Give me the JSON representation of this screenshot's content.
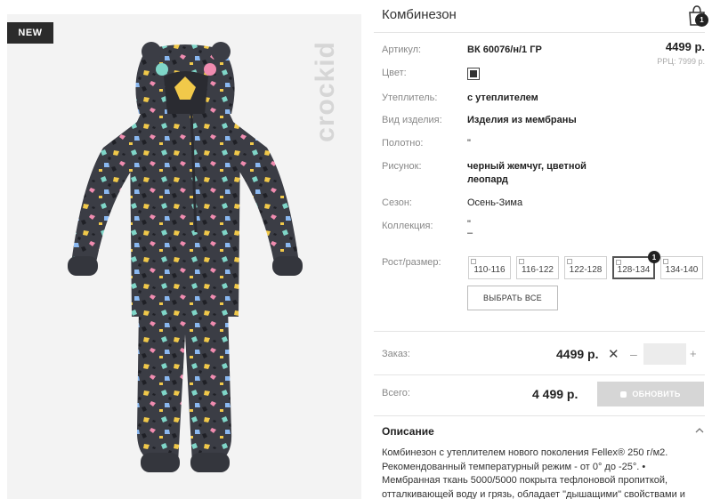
{
  "product": {
    "badge": "NEW",
    "brand": "crockid",
    "title": "Комбинезон"
  },
  "cart": {
    "count": "1"
  },
  "attributes": {
    "article_label": "Артикул:",
    "article_value": "ВК 60076/н/1 ГР",
    "color_label": "Цвет:",
    "insulation_label": "Утеплитель:",
    "insulation_value": "с утеплителем",
    "kind_label": "Вид изделия:",
    "kind_value": "Изделия из мембраны",
    "fabric_label": "Полотно:",
    "fabric_value": "\"",
    "pattern_label": "Рисунок:",
    "pattern_value_1": "черный жемчуг, цветной",
    "pattern_value_2": "леопард",
    "season_label": "Сезон:",
    "season_value": "Осень-Зима",
    "collection_label": "Коллекция:",
    "collection_value_1": "\"",
    "collection_value_2": "–"
  },
  "pricing": {
    "price": "4499 р.",
    "rrp": "РРЦ: 7999 р."
  },
  "sizes": {
    "label": "Рост/размер:",
    "items": [
      "110-116",
      "116-122",
      "122-128",
      "128-134",
      "134-140"
    ],
    "selected_count": "1",
    "select_all": "ВЫБРАТЬ ВСЕ"
  },
  "order": {
    "label": "Заказ:",
    "price": "4499 р.",
    "times": "✕",
    "minus": "–",
    "plus": "+"
  },
  "total": {
    "label": "Всего:",
    "value": "4 499 р.",
    "update_button": "ОБНОВИТЬ"
  },
  "description": {
    "heading": "Описание",
    "line1": "Комбинезон с утеплителем нового поколения Fellex® 250 г/м2.",
    "line2": "Рекомендованный температурный режим - от 0° до -25°. •",
    "line3": "Мембранная ткань 5000/5000 покрыта тефлоновой пропиткой,",
    "line4": "отталкивающей воду и грязь, обладает \"дышащими\" свойствами и"
  },
  "colors": {
    "suit": "#3b3d45",
    "badge_bg": "#2b2b2b",
    "muted_button": "#d6d6d6"
  },
  "icons": [
    "cart-icon",
    "checkbox-icon",
    "chevron-up-icon",
    "refresh-icon"
  ]
}
